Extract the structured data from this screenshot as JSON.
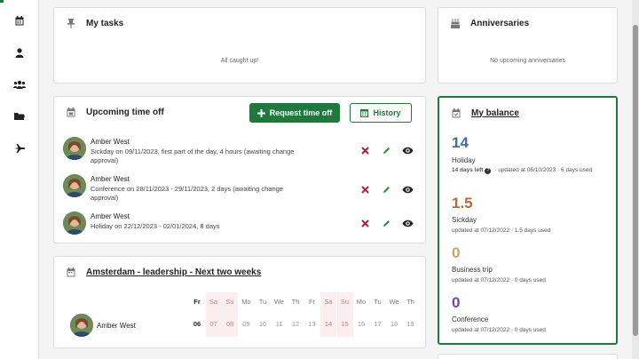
{
  "nav": {
    "icons": [
      "calendar-icon",
      "person-icon",
      "team-icon",
      "folder-icon",
      "airplane-icon"
    ]
  },
  "my_tasks": {
    "title": "My tasks",
    "empty_text": "All caught up!"
  },
  "anniversaries": {
    "title": "Anniversaries",
    "empty_text": "No upcoming anniversaries"
  },
  "upcoming_time_off": {
    "title": "Upcoming time off",
    "request_button": "Request time off",
    "history_button": "History",
    "items": [
      {
        "name": "Amber West",
        "description": "Sickday on 09/11/2023, first part of the day, 4 hours (awaiting change approval)"
      },
      {
        "name": "Amber West",
        "description": "Conference on 28/11/2023 - 29/11/2023, 2 days (awaiting change approval)"
      },
      {
        "name": "Amber West",
        "description": "Holiday on 22/12/2023 - 02/01/2024, 8 days"
      }
    ]
  },
  "team_calendar": {
    "title": "Amsterdam - leadership - Next two weeks",
    "month": "06",
    "employee": "Amber West",
    "days": [
      {
        "dow": "Fr",
        "date": "06",
        "weekend": false,
        "current": true
      },
      {
        "dow": "Sa",
        "date": "07",
        "weekend": true,
        "current": false
      },
      {
        "dow": "Su",
        "date": "08",
        "weekend": true,
        "current": false
      },
      {
        "dow": "Mo",
        "date": "09",
        "weekend": false,
        "current": false
      },
      {
        "dow": "Tu",
        "date": "10",
        "weekend": false,
        "current": false
      },
      {
        "dow": "We",
        "date": "11",
        "weekend": false,
        "current": false
      },
      {
        "dow": "Th",
        "date": "12",
        "weekend": false,
        "current": false
      },
      {
        "dow": "Fr",
        "date": "13",
        "weekend": false,
        "current": false
      },
      {
        "dow": "Sa",
        "date": "14",
        "weekend": true,
        "current": false
      },
      {
        "dow": "Su",
        "date": "15",
        "weekend": true,
        "current": false
      },
      {
        "dow": "Mo",
        "date": "16",
        "weekend": false,
        "current": false
      },
      {
        "dow": "Tu",
        "date": "17",
        "weekend": false,
        "current": false
      },
      {
        "dow": "We",
        "date": "18",
        "weekend": false,
        "current": false
      },
      {
        "dow": "Th",
        "date": "19",
        "weekend": false,
        "current": false
      }
    ]
  },
  "my_balance": {
    "title": "My balance",
    "entries": [
      {
        "value": "14",
        "label": "Holiday",
        "detail_bold": "14 days left",
        "detail": " · updated at 06/10/2023 · 6 days used",
        "color": "#3f6fa8"
      },
      {
        "value": "1.5",
        "label": "Sickday",
        "detail_bold": "",
        "detail": "updated at 07/12/2022 · 1.5 days used",
        "color": "#b86a3a"
      },
      {
        "value": "0",
        "label": "Business trip",
        "detail_bold": "",
        "detail": "updated at 07/12/2022 · 0 days used",
        "color": "#c9a35a"
      },
      {
        "value": "0",
        "label": "Conference",
        "detail_bold": "",
        "detail": "updated at 07/12/2022 · 0 days used",
        "color": "#7a3fb5"
      }
    ]
  },
  "colors": {
    "accent": "#1e7a3c",
    "delete": "#b2213a",
    "edit": "#2e8b3e",
    "weekend_bg": "#fbeeee"
  }
}
